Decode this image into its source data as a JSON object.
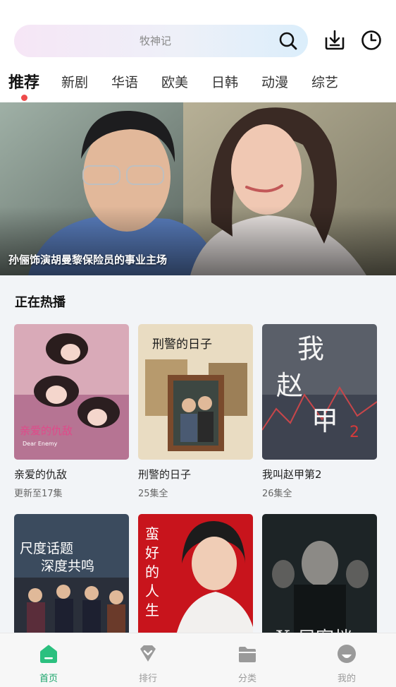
{
  "search": {
    "placeholder_text": "牧神记"
  },
  "header": {
    "download_icon": "download-icon",
    "history_icon": "clock-icon"
  },
  "tabs": [
    {
      "label": "推荐",
      "active": true
    },
    {
      "label": "新剧"
    },
    {
      "label": "华语"
    },
    {
      "label": "欧美"
    },
    {
      "label": "日韩"
    },
    {
      "label": "动漫"
    },
    {
      "label": "综艺"
    }
  ],
  "banner": {
    "caption": "孙俪饰演胡曼黎保险员的事业主场"
  },
  "section": {
    "title": "正在热播"
  },
  "shows": [
    {
      "title": "亲爱的仇敌",
      "subtitle": "更新至17集",
      "poster_text": "亲爱的仇敌",
      "poster_sub": "Dear Enemy"
    },
    {
      "title": "刑警的日子",
      "subtitle": "25集全",
      "poster_text": "刑警的日子"
    },
    {
      "title": "我叫赵甲第2",
      "subtitle": "26集全",
      "poster_text": "我叫赵甲第"
    },
    {
      "title": "",
      "subtitle": "",
      "poster_text": "尺度话题 深度共鸣"
    },
    {
      "title": "",
      "subtitle": "",
      "poster_text": "蛮好的人生"
    },
    {
      "title": "",
      "subtitle": "",
      "poster_text": "X尼密档"
    }
  ],
  "bottom_nav": [
    {
      "label": "首页",
      "icon": "home-icon",
      "active": true
    },
    {
      "label": "排行",
      "icon": "rank-icon"
    },
    {
      "label": "分类",
      "icon": "folder-icon"
    },
    {
      "label": "我的",
      "icon": "profile-icon"
    }
  ],
  "colors": {
    "accent_green": "#1aa56b",
    "tab_dot_red": "#ee4b4b",
    "content_bg": "#f2f4f7"
  }
}
